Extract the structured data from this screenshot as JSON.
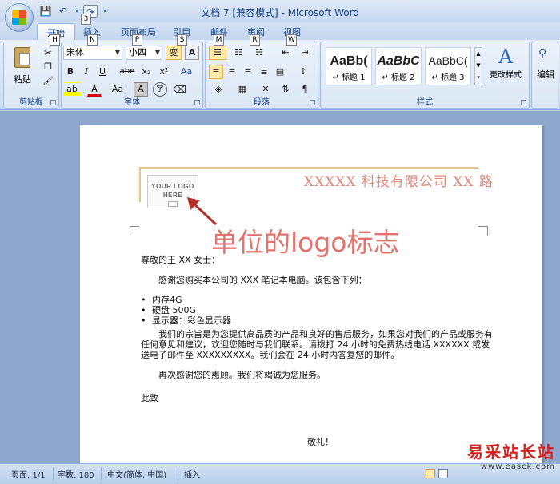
{
  "window": {
    "title": "文档 7 [兼容模式] - Microsoft Word"
  },
  "qat": {
    "save": "💾",
    "undo": "↶",
    "redo": "↷",
    "more": "▾"
  },
  "keytips": [
    "3",
    "H",
    "N",
    "P",
    "S",
    "M",
    "R",
    "W"
  ],
  "tabs": [
    "开始",
    "插入",
    "页面布局",
    "引用",
    "邮件",
    "审阅",
    "视图"
  ],
  "ribbon": {
    "clipboard": {
      "paste": "粘贴",
      "label": "剪贴板"
    },
    "font": {
      "name": "宋体",
      "size": "小四",
      "phonetic": "变",
      "border": "A",
      "bold": "B",
      "italic": "I",
      "underline": "U",
      "strike": "abe",
      "sub": "x₂",
      "sup": "x²",
      "clear": "Aa",
      "color": "A",
      "grow": "Aa",
      "shade": "A",
      "enclose": "字",
      "label": "字体"
    },
    "paragraph": {
      "label": "段落"
    },
    "styles": {
      "items": [
        {
          "sample": "AaBb(",
          "name": "↵ 标题 1"
        },
        {
          "sample": "AaBbC",
          "name": "↵ 标题 2"
        },
        {
          "sample": "AaBbC(",
          "name": "↵ 标题 3"
        }
      ],
      "change": "更改样式",
      "label": "样式"
    },
    "editing": {
      "label": "编辑"
    }
  },
  "document": {
    "logo_text": [
      "YOUR LOGO",
      "HERE"
    ],
    "company": "XXXXX 科技有限公司 XX 路",
    "callout": "单位的logo标志",
    "salutation": "尊敬的王 XX 女士：",
    "intro": "感谢您购买本公司的 XXX 笔记本电脑。该包含下列：",
    "items": [
      "内存4G",
      "硬盘 500G",
      "显示器：彩色显示器"
    ],
    "body": "我们的宗旨是为您提供高品质的产品和良好的售后服务，如果您对我们的产品或服务有任何意见和建议，欢迎您随时与我们联系。请拨打 24 小时的免费热线电话 XXXXXX 或发送电子邮件至 XXXXXXXXX。我们会在 24 小时内答复您的邮件。",
    "thanks": "再次感谢您的惠顾。我们将竭诚为您服务。",
    "closing1": "此致",
    "closing2": "敬礼！"
  },
  "statusbar": {
    "page": "页面: 1/1",
    "words": "字数: 180",
    "lang": "中文(简体, 中国)",
    "mode": "插入"
  },
  "watermark": {
    "cn": "易采站长站",
    "en": "www.easck.com"
  },
  "colors": {
    "accent": "#15428b",
    "callout": "#e4736d",
    "company": "#e0877a",
    "header_line": "#e9c28a"
  }
}
